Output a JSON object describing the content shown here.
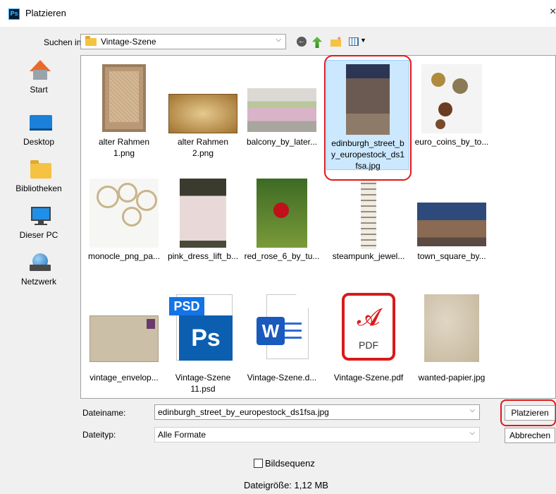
{
  "window": {
    "title": "Platzieren",
    "app_badge": "Ps",
    "close_glyph": "×"
  },
  "lookin": {
    "label": "Suchen in:",
    "value": "Vintage-Szene"
  },
  "places": [
    {
      "label": "Start",
      "icon": "home-icon"
    },
    {
      "label": "Desktop",
      "icon": "desktop-icon"
    },
    {
      "label": "Bibliotheken",
      "icon": "library-icon"
    },
    {
      "label": "Dieser PC",
      "icon": "computer-icon"
    },
    {
      "label": "Netzwerk",
      "icon": "network-icon"
    }
  ],
  "files": [
    {
      "name": "alter Rahmen\n1.png"
    },
    {
      "name": "alter Rahmen\n2.png"
    },
    {
      "name": "balcony_by_later..."
    },
    {
      "name": "edinburgh_street_b\ny_europestock_ds1\nfsa.jpg",
      "selected": true
    },
    {
      "name": "euro_coins_by_to..."
    },
    {
      "name": "monocle_png_pa..."
    },
    {
      "name": "pink_dress_lift_b..."
    },
    {
      "name": "red_rose_6_by_tu..."
    },
    {
      "name": "steampunk_jewel..."
    },
    {
      "name": "town_square_by..."
    },
    {
      "name": "vintage_envelop..."
    },
    {
      "name": "Vintage-Szene\n11.psd",
      "badge": "PSD",
      "glyph": "Ps"
    },
    {
      "name": "Vintage-Szene.d...",
      "glyph": "W"
    },
    {
      "name": "Vintage-Szene.pdf",
      "glyph": "PDF"
    },
    {
      "name": "wanted-papier.jpg"
    }
  ],
  "filename": {
    "label": "Dateiname:",
    "value": "edinburgh_street_by_europestock_ds1fsa.jpg"
  },
  "filetype": {
    "label": "Dateityp:",
    "value": "Alle Formate"
  },
  "buttons": {
    "place": "Platzieren",
    "cancel": "Abbrechen"
  },
  "sequence": {
    "label": "Bildsequenz",
    "checked": false
  },
  "filesize": "Dateigröße: 1,12 MB",
  "colors": {
    "accent_red": "#e01818",
    "selection_bg": "#cce8ff",
    "selection_border": "#99d1ff"
  }
}
